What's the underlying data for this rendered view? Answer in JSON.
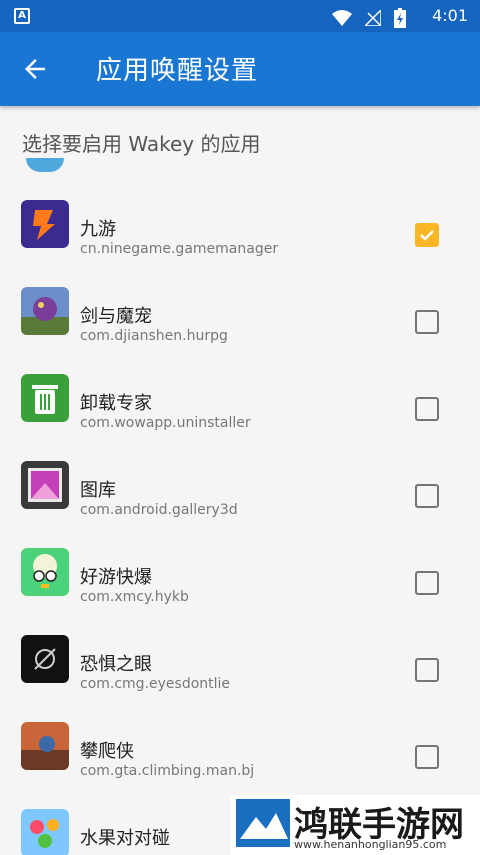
{
  "status_bar": {
    "badge": "A",
    "time": "4:01"
  },
  "app_bar": {
    "title": "应用唤醒设置"
  },
  "subheader": "选择要启用 Wakey 的应用",
  "apps": [
    {
      "name": "九游",
      "package": "cn.ninegame.gamemanager",
      "checked": true,
      "icon": "jiuyou-icon"
    },
    {
      "name": "剑与魔宠",
      "package": "com.djianshen.hurpg",
      "checked": false,
      "icon": "jianyumochong-icon"
    },
    {
      "name": "卸载专家",
      "package": "com.wowapp.uninstaller",
      "checked": false,
      "icon": "trash-icon"
    },
    {
      "name": "图库",
      "package": "com.android.gallery3d",
      "checked": false,
      "icon": "gallery-icon"
    },
    {
      "name": "好游快爆",
      "package": "com.xmcy.hykb",
      "checked": false,
      "icon": "hykb-icon"
    },
    {
      "name": "恐惧之眼",
      "package": "com.cmg.eyesdontlie",
      "checked": false,
      "icon": "eye-icon"
    },
    {
      "name": "攀爬侠",
      "package": "com.gta.climbing.man.bj",
      "checked": false,
      "icon": "climbing-icon"
    },
    {
      "name": "水果对对碰",
      "package": "",
      "checked": false,
      "icon": "fruit-icon"
    }
  ],
  "watermark": {
    "title": "鸿联手游网",
    "url": "www.henanhonglian95.com"
  },
  "colors": {
    "status_bar": "#1565c0",
    "app_bar": "#1976d2",
    "checkbox_checked": "#fbb626"
  }
}
